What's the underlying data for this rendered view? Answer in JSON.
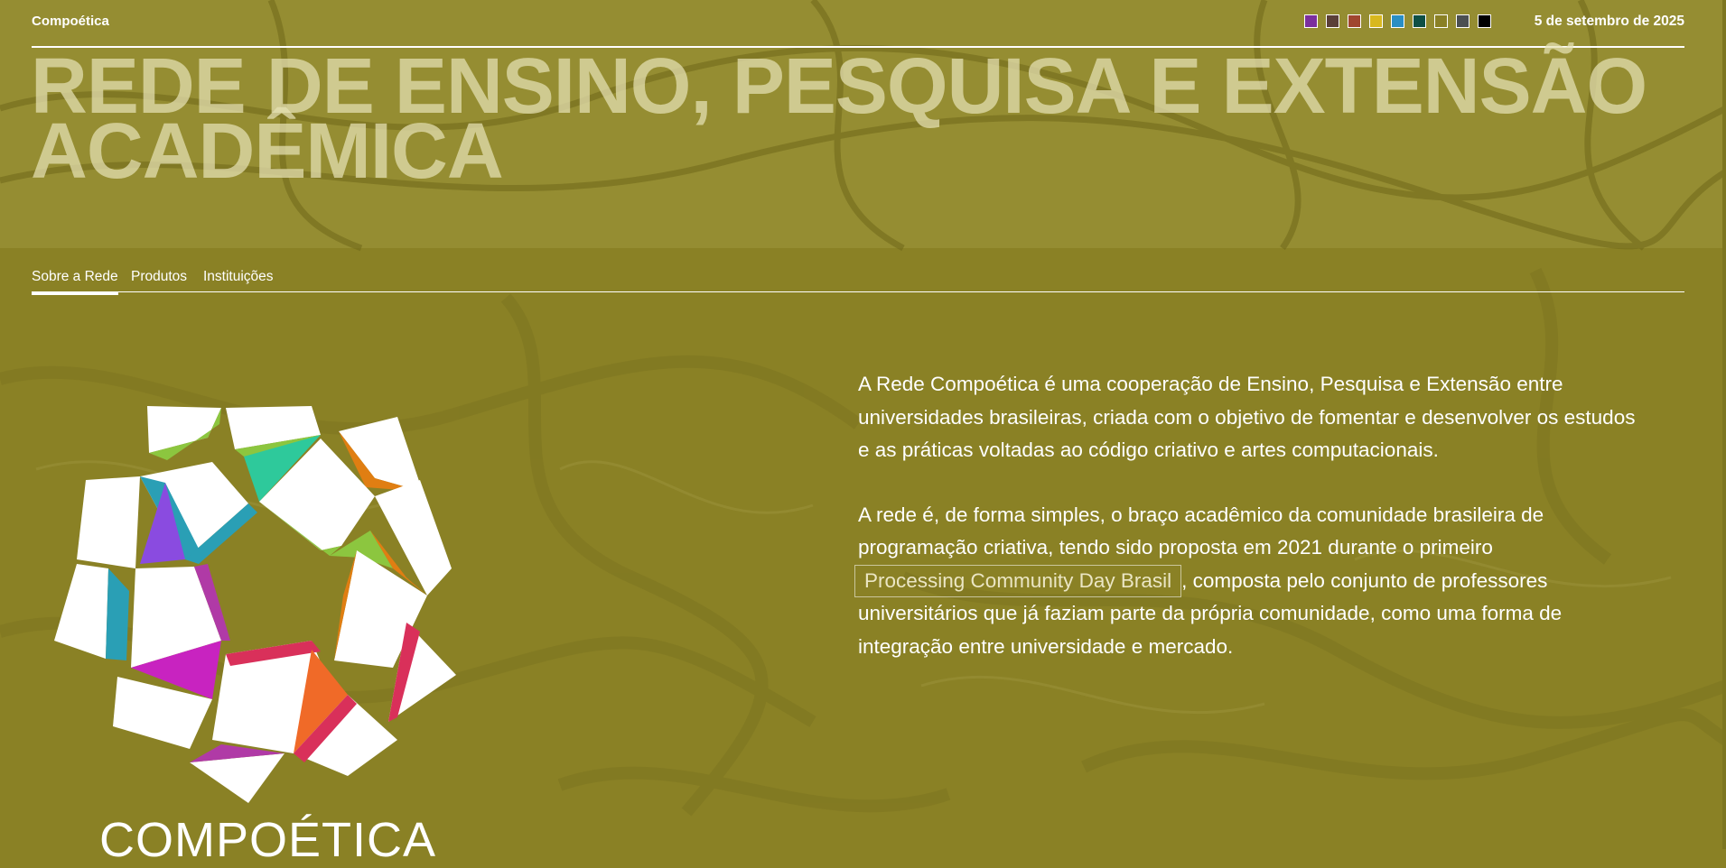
{
  "header": {
    "brand": "Compoética",
    "date": "5 de setembro de 2025",
    "palette_swatches": [
      "#7b2f9e",
      "#5a3f38",
      "#a0462f",
      "#d8b81e",
      "#2a8ec4",
      "#0e4f45",
      "#8a8025",
      "#4b4f52",
      "#000000"
    ]
  },
  "hero": {
    "title_line1": "REDE DE ENSINO, PESQUISA E EXTENSÃO",
    "title_line2": "ACADÊMICA"
  },
  "tabs": [
    {
      "label": "Sobre a Rede",
      "active": true
    },
    {
      "label": "Produtos",
      "active": false
    },
    {
      "label": "Instituições",
      "active": false
    }
  ],
  "logo": {
    "wordmark": "COMPOÉTICA"
  },
  "about": {
    "paragraph1": "A Rede Compoética é uma cooperação de Ensino, Pesquisa e Extensão entre universidades brasileiras, criada com o objetivo de fomentar e desenvolver os estudos e as práticas voltadas ao código criativo e artes computacionais.",
    "paragraph2_before": "A rede é, de forma simples, o braço acadêmico da comunidade brasileira de programação criativa, tendo sido proposta em 2021 durante o primeiro",
    "paragraph2_link": "Processing Community Day Brasil",
    "paragraph2_after": ", composta pelo conjunto de professores universitários que já faziam parte da própria comunidade, como uma forma de integração entre universidade e mercado."
  },
  "colors": {
    "background": "#8a8125",
    "headline": "#e6e2b4",
    "text": "#ffffff"
  }
}
